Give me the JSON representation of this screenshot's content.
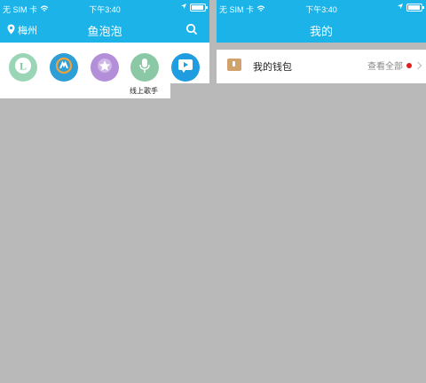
{
  "left": {
    "status": {
      "carrier": "无 SIM 卡",
      "time": "下午3:40",
      "battery_level": 0.9
    },
    "nav": {
      "location": "梅州",
      "title": "鱼泡泡"
    },
    "shortcuts": [
      {
        "icon": "letter-l-icon",
        "label": "",
        "color": "#9ad6b6"
      },
      {
        "icon": "overwatch-icon",
        "label": "",
        "color": "#2e9fd6"
      },
      {
        "icon": "star-icon",
        "label": "",
        "color": "#b48fd9"
      },
      {
        "icon": "microphone-icon",
        "label": "线上歌手",
        "color": "#8bc9a6"
      },
      {
        "icon": "play-icon",
        "label": "",
        "color": "#1f9de0"
      }
    ]
  },
  "right": {
    "status": {
      "carrier": "无 SIM 卡",
      "time": "下午3:40",
      "battery_level": 0.9
    },
    "nav": {
      "title": "我的"
    },
    "wallet": {
      "label": "我的钱包",
      "action": "查看全部"
    }
  }
}
